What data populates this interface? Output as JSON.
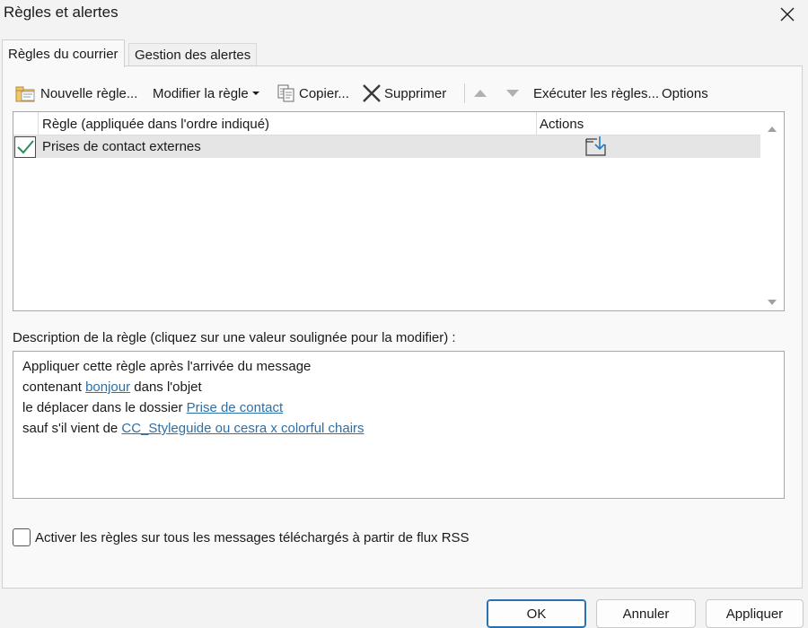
{
  "window": {
    "title": "Règles et alertes"
  },
  "tabs": [
    {
      "label": "Règles du courrier",
      "active": true
    },
    {
      "label": "Gestion des alertes",
      "active": false
    }
  ],
  "toolbar": {
    "new_rule": "Nouvelle règle...",
    "modify_rule": "Modifier la règle",
    "copy": "Copier...",
    "delete": "Supprimer",
    "run_rules": "Exécuter les règles...",
    "options": "Options"
  },
  "rule_list": {
    "columns": [
      "Règle (appliquée dans l'ordre indiqué)",
      "Actions"
    ],
    "rows": [
      {
        "name": "Prises de contact externes",
        "enabled": true,
        "action_icon": "move-to-folder-icon"
      }
    ]
  },
  "description": {
    "label": "Description de la règle (cliquez sur une valeur soulignée pour la modifier) :",
    "line1": "Appliquer cette règle après l'arrivée du message",
    "line2_prefix": "contenant ",
    "line2_link": "bonjour",
    "line2_suffix": " dans l'objet",
    "line3_prefix": "le déplacer dans le dossier ",
    "line3_link": "Prise de contact",
    "line4_prefix": "sauf s'il vient de ",
    "line4_link": "CC_Styleguide ou cesra x colorful chairs"
  },
  "rss": {
    "label": "Activer les règles sur tous les messages téléchargés à partir de flux RSS",
    "checked": false
  },
  "buttons": {
    "ok": "OK",
    "cancel": "Annuler",
    "apply": "Appliquer"
  },
  "colors": {
    "link": "#2d6fa7",
    "selected_row": "#e5e5e5",
    "check_green": "#2e8b57",
    "action_blue": "#1f7bd1"
  }
}
